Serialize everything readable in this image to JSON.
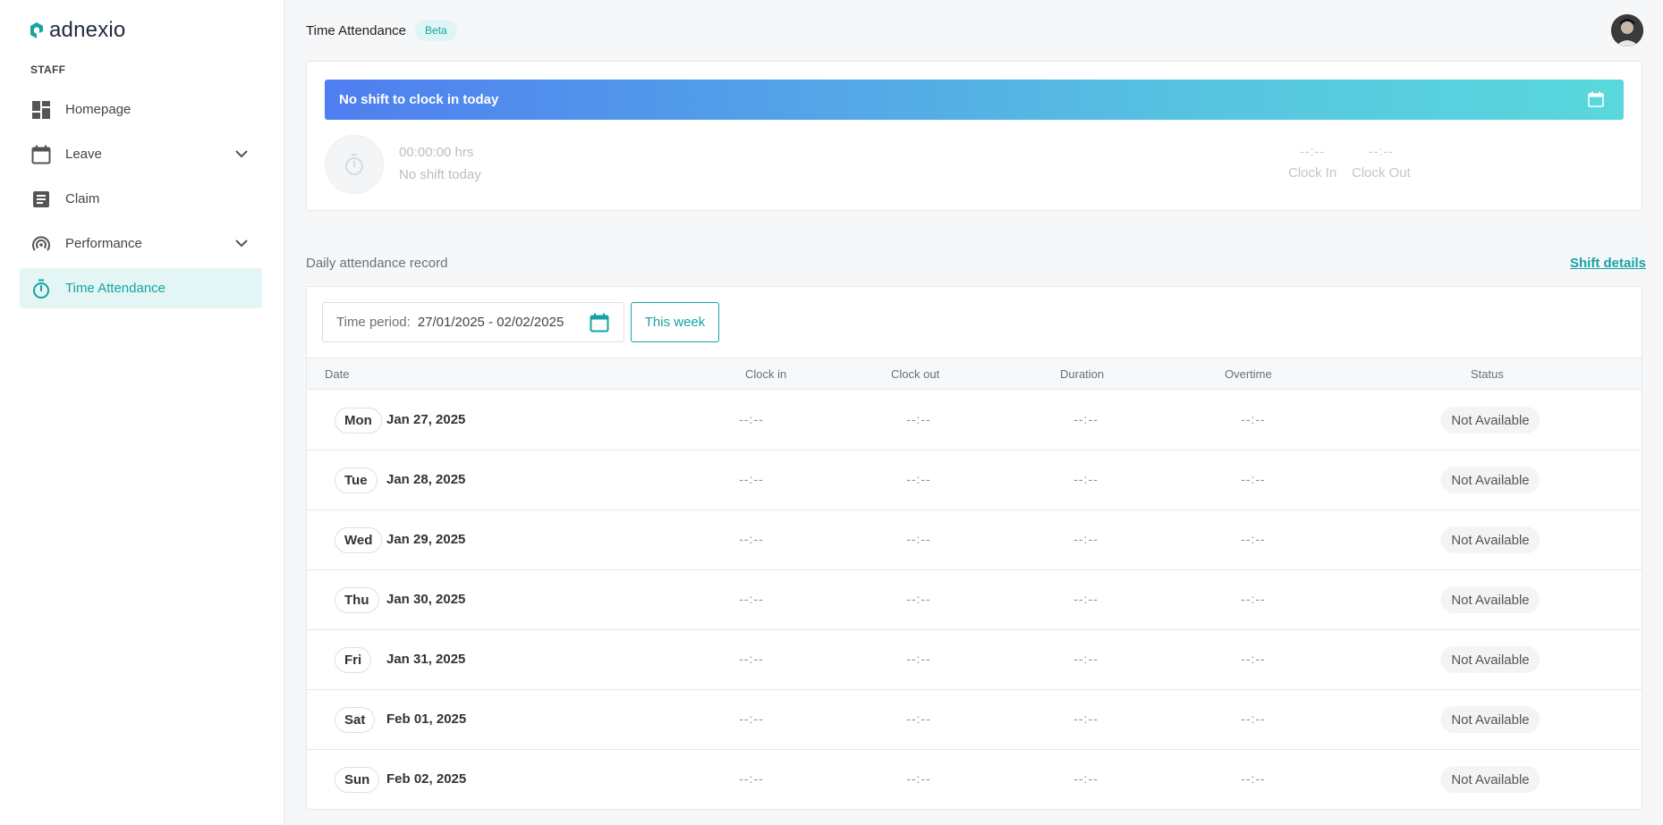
{
  "brand": {
    "name": "adnexio",
    "color": "#17a3a3"
  },
  "sidebar": {
    "section_label": "STAFF",
    "items": [
      {
        "label": "Homepage",
        "icon": "dashboard-icon"
      },
      {
        "label": "Leave",
        "icon": "calendar-icon",
        "expandable": true
      },
      {
        "label": "Claim",
        "icon": "document-icon"
      },
      {
        "label": "Performance",
        "icon": "performance-icon",
        "expandable": true
      },
      {
        "label": "Time Attendance",
        "icon": "stopwatch-icon",
        "active": true
      }
    ]
  },
  "header": {
    "title": "Time Attendance",
    "badge": "Beta"
  },
  "clock_card": {
    "banner": "No shift to clock in today",
    "hours": "00:00:00 hrs",
    "shift_status": "No shift today",
    "clock_in_value": "--:--",
    "clock_in_label": "Clock In",
    "clock_out_value": "--:--",
    "clock_out_label": "Clock Out"
  },
  "records": {
    "title": "Daily attendance record",
    "shift_details_link": "Shift details",
    "period_label": "Time period:",
    "period_value": "27/01/2025 - 02/02/2025",
    "this_week_button": "This week",
    "columns": [
      "Date",
      "Clock in",
      "Clock out",
      "Duration",
      "Overtime",
      "Status"
    ],
    "rows": [
      {
        "day": "Mon",
        "date": "Jan 27, 2025",
        "clock_in": "--:--",
        "clock_out": "--:--",
        "duration": "--:--",
        "overtime": "--:--",
        "status": "Not Available"
      },
      {
        "day": "Tue",
        "date": "Jan 28, 2025",
        "clock_in": "--:--",
        "clock_out": "--:--",
        "duration": "--:--",
        "overtime": "--:--",
        "status": "Not Available"
      },
      {
        "day": "Wed",
        "date": "Jan 29, 2025",
        "clock_in": "--:--",
        "clock_out": "--:--",
        "duration": "--:--",
        "overtime": "--:--",
        "status": "Not Available"
      },
      {
        "day": "Thu",
        "date": "Jan 30, 2025",
        "clock_in": "--:--",
        "clock_out": "--:--",
        "duration": "--:--",
        "overtime": "--:--",
        "status": "Not Available"
      },
      {
        "day": "Fri",
        "date": "Jan 31, 2025",
        "clock_in": "--:--",
        "clock_out": "--:--",
        "duration": "--:--",
        "overtime": "--:--",
        "status": "Not Available"
      },
      {
        "day": "Sat",
        "date": "Feb 01, 2025",
        "clock_in": "--:--",
        "clock_out": "--:--",
        "duration": "--:--",
        "overtime": "--:--",
        "status": "Not Available"
      },
      {
        "day": "Sun",
        "date": "Feb 02, 2025",
        "clock_in": "--:--",
        "clock_out": "--:--",
        "duration": "--:--",
        "overtime": "--:--",
        "status": "Not Available"
      }
    ]
  }
}
